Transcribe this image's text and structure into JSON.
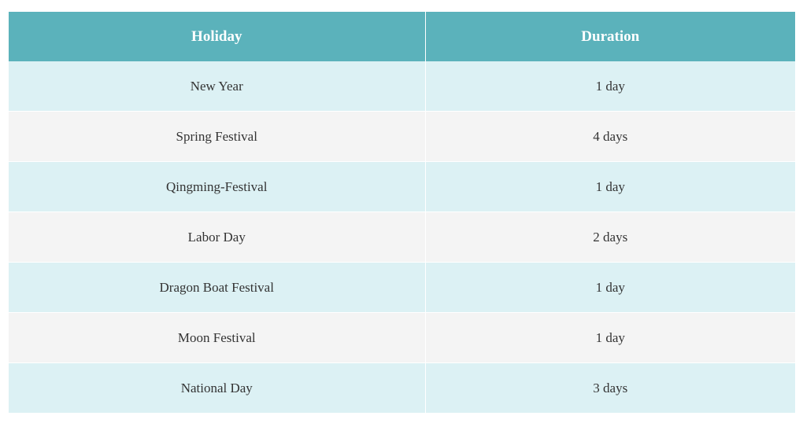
{
  "table": {
    "headers": [
      "Holiday",
      "Duration"
    ],
    "rows": [
      [
        "New Year",
        "1 day"
      ],
      [
        "Spring Festival",
        "4 days"
      ],
      [
        "Qingming-Festival",
        "1 day"
      ],
      [
        "Labor Day",
        "2 days"
      ],
      [
        "Dragon Boat Festival",
        "1 day"
      ],
      [
        "Moon Festival",
        "1 day"
      ],
      [
        "National Day",
        "3 days"
      ]
    ]
  },
  "colors": {
    "header_bg": "#5bb2bb",
    "row_odd_bg": "#dcf1f4",
    "row_even_bg": "#f4f4f4"
  }
}
